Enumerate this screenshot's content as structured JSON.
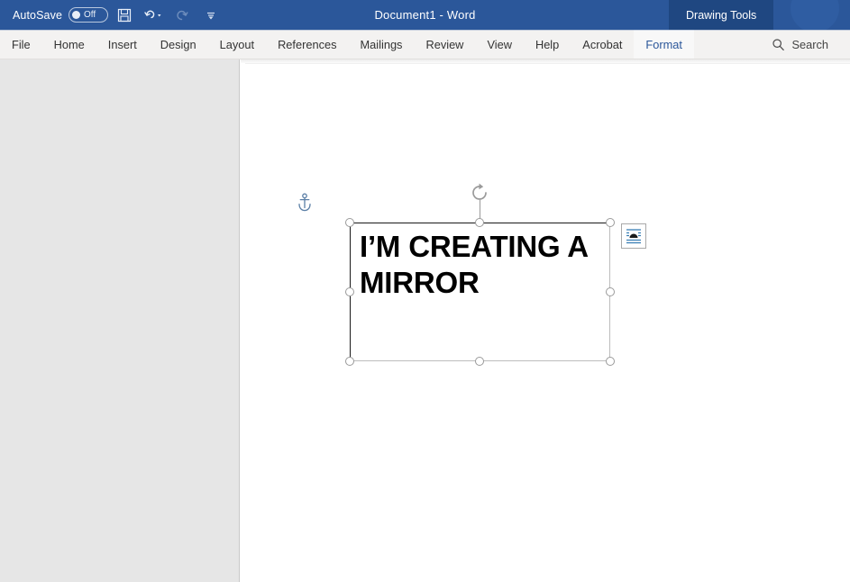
{
  "titlebar": {
    "autosave_label": "AutoSave",
    "autosave_state": "Off",
    "document_title": "Document1  -  Word",
    "contextual_tab_title": "Drawing Tools",
    "quick_access": [
      {
        "name": "save-icon",
        "label": "Save",
        "disabled": false
      },
      {
        "name": "undo-icon",
        "label": "Undo",
        "disabled": false
      },
      {
        "name": "redo-icon",
        "label": "Redo",
        "disabled": true
      },
      {
        "name": "customize-quick-access-icon",
        "label": "Customize Quick Access Toolbar",
        "disabled": false
      }
    ]
  },
  "ribbon": {
    "tabs": [
      {
        "label": "File",
        "contextual": false
      },
      {
        "label": "Home",
        "contextual": false
      },
      {
        "label": "Insert",
        "contextual": false
      },
      {
        "label": "Design",
        "contextual": false
      },
      {
        "label": "Layout",
        "contextual": false
      },
      {
        "label": "References",
        "contextual": false
      },
      {
        "label": "Mailings",
        "contextual": false
      },
      {
        "label": "Review",
        "contextual": false
      },
      {
        "label": "View",
        "contextual": false
      },
      {
        "label": "Help",
        "contextual": false
      },
      {
        "label": "Acrobat",
        "contextual": false
      },
      {
        "label": "Format",
        "contextual": true
      }
    ],
    "search_label": "Search",
    "search_icon": "search-icon"
  },
  "canvas": {
    "anchor_icon": "anchor-icon",
    "rotation_handle_icon": "rotate-icon",
    "layout_options_icon": "layout-options-icon",
    "textbox": {
      "text": "I’M CREATING A MIRROR",
      "handles": [
        "top-left",
        "top-center",
        "top-right",
        "middle-left",
        "middle-right",
        "bottom-left",
        "bottom-center",
        "bottom-right"
      ]
    }
  },
  "colors": {
    "title_bar": "#2b579a",
    "contextual_tab_bg": "#1f4781",
    "ribbon_bg": "#f3f2f1",
    "accent_text": "#2b579a",
    "side_panel": "#e6e6e6",
    "shape_border_dark": "#1a1a1a",
    "shape_border_light": "#bdbdbd",
    "handle_border": "#9a9a9a",
    "anchor": "#5b7fa6"
  }
}
